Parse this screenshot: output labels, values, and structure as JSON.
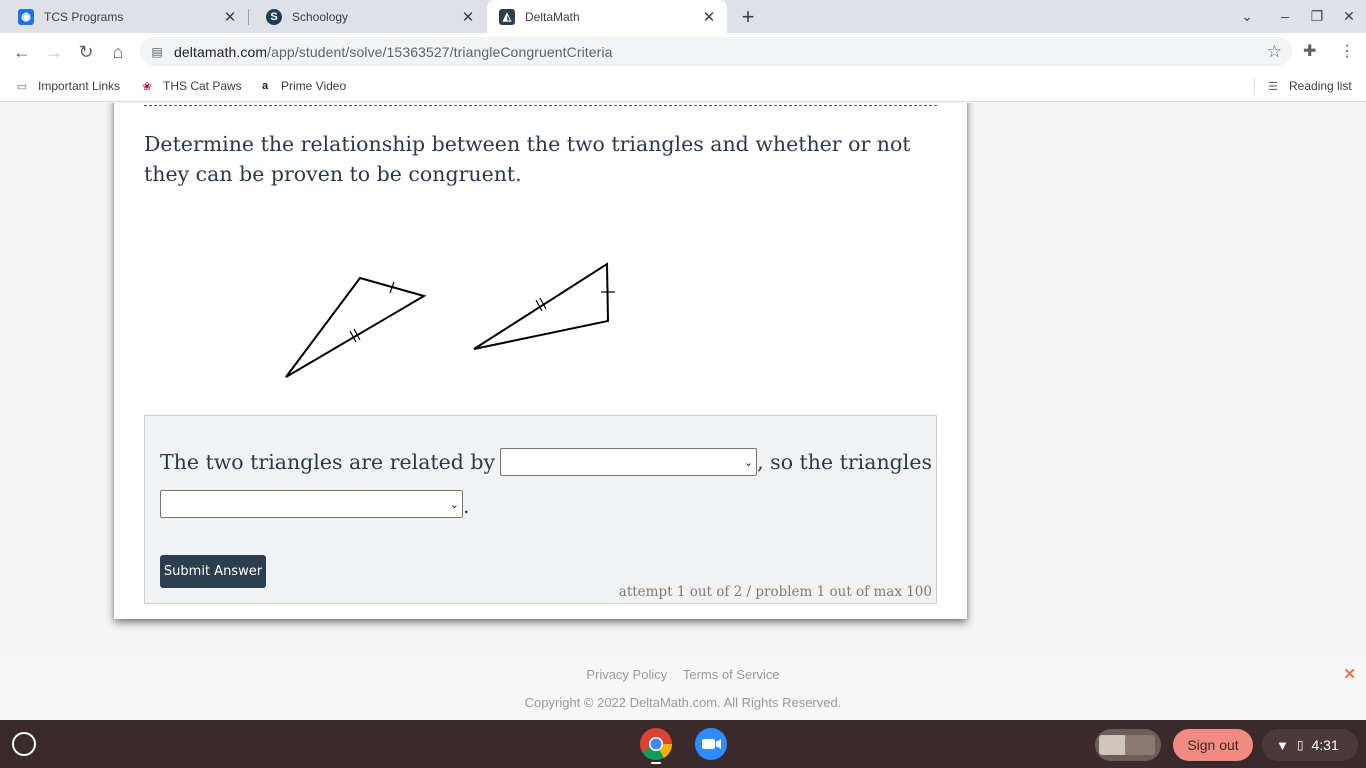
{
  "browser": {
    "tabs": [
      {
        "title": "TCS Programs",
        "favicon": "tcs-icon",
        "active": false
      },
      {
        "title": "Schoology",
        "favicon": "schoology-icon",
        "active": false
      },
      {
        "title": "DeltaMath",
        "favicon": "deltamath-icon",
        "active": true
      }
    ],
    "url_host": "deltamath.com",
    "url_path": "/app/student/solve/15363527/triangleCongruentCriteria",
    "bookmarks": [
      {
        "label": "Important Links",
        "icon": "folder-icon"
      },
      {
        "label": "THS Cat Paws",
        "icon": "paw-icon"
      },
      {
        "label": "Prime Video",
        "icon": "amazon-icon"
      }
    ],
    "reading_list": "Reading list"
  },
  "problem": {
    "prompt": "Determine the relationship between the two triangles and whether or not they can be proven to be congruent.",
    "answer_prefix": "The two triangles are related by",
    "answer_mid": ", so the triangles",
    "answer_end": ".",
    "select1_value": "",
    "select2_value": "",
    "submit_label": "Submit Answer",
    "attempt_text": "attempt 1 out of 2 / problem 1 out of max 100"
  },
  "footer": {
    "privacy": "Privacy Policy",
    "terms": "Terms of Service",
    "copyright": "Copyright © 2022 DeltaMath.com. All Rights Reserved."
  },
  "shelf": {
    "signout": "Sign out",
    "time": "4:31"
  },
  "colors": {
    "submit_bg": "#2c3e50",
    "signout_bg": "#f28b82",
    "shelf_bg": "#3a2a2b",
    "prompt_text": "#2b3a4a"
  }
}
